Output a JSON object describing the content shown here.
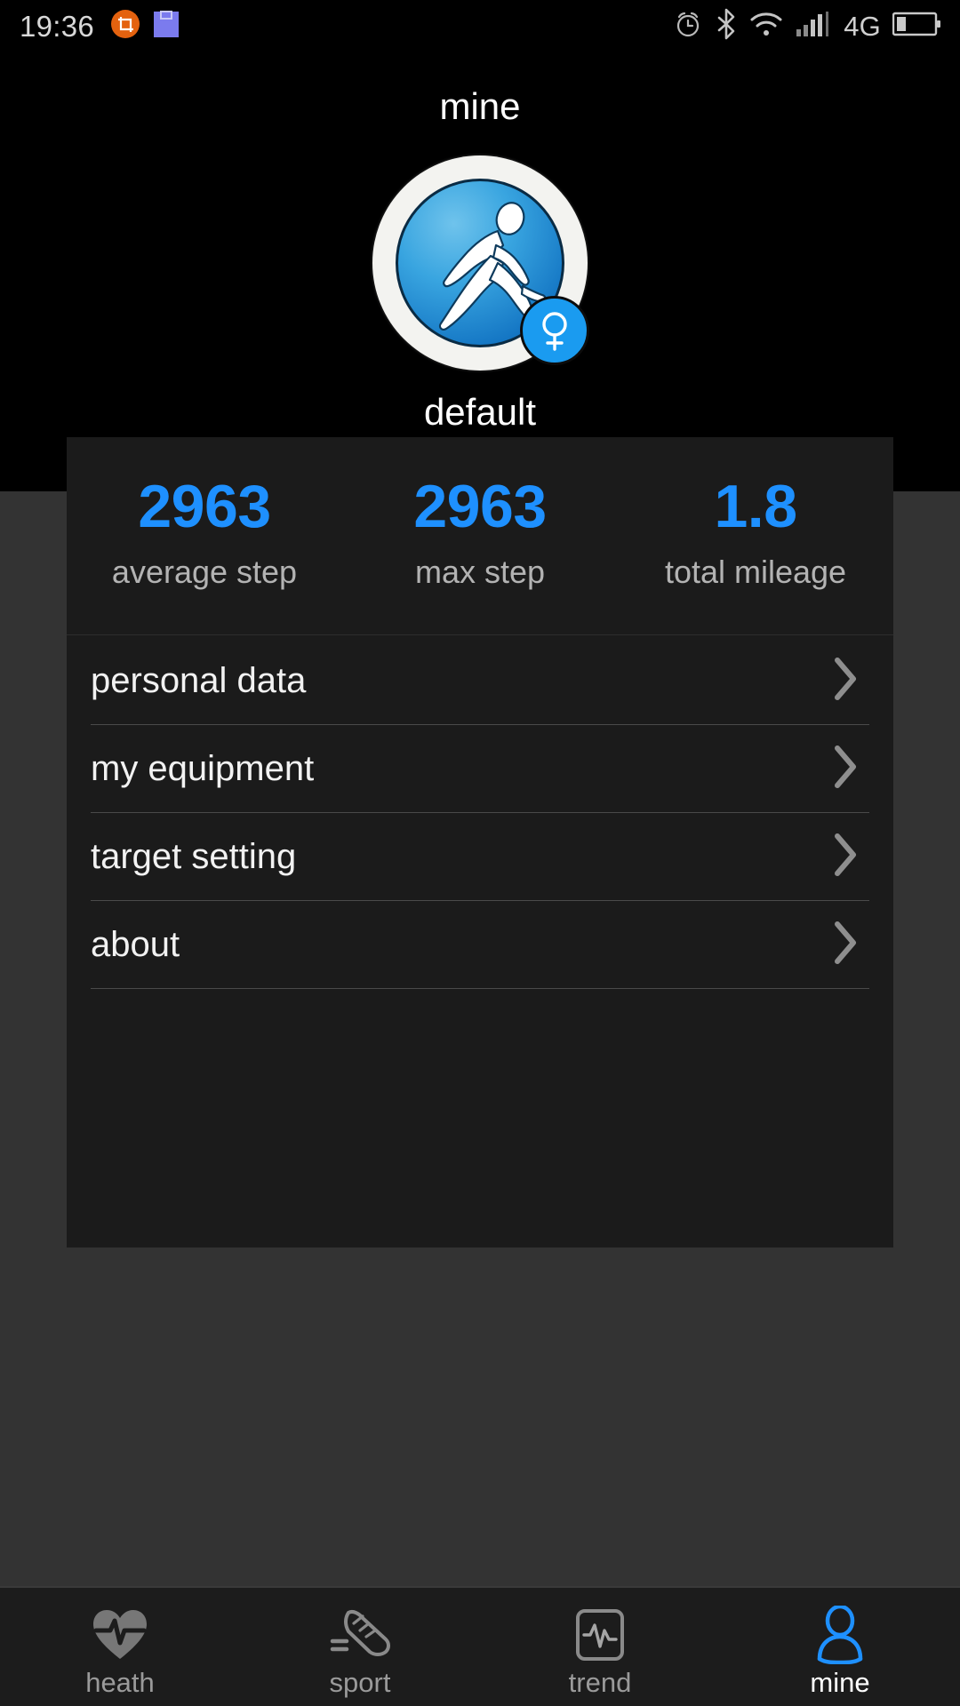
{
  "status_bar": {
    "time": "19:36",
    "left_icons": [
      "screenshot-crop-icon",
      "save-file-icon"
    ],
    "right_icons": [
      "alarm-icon",
      "bluetooth-icon",
      "wifi-icon",
      "signal-bars-icon",
      "battery-icon"
    ],
    "network_label": "4G"
  },
  "header": {
    "title": "mine"
  },
  "profile": {
    "avatar_icon": "running-person-avatar",
    "gender_badge_icon": "female-gender-icon",
    "name": "default"
  },
  "stats": [
    {
      "value": "2963",
      "label": "average step"
    },
    {
      "value": "2963",
      "label": "max step"
    },
    {
      "value": "1.8",
      "label": "total mileage"
    }
  ],
  "menu": [
    {
      "label": "personal data"
    },
    {
      "label": "my equipment"
    },
    {
      "label": "target setting"
    },
    {
      "label": "about"
    }
  ],
  "bottom_nav": [
    {
      "label": "heath",
      "icon": "heart-pulse-icon",
      "active": false
    },
    {
      "label": "sport",
      "icon": "running-shoe-icon",
      "active": false
    },
    {
      "label": "trend",
      "icon": "chart-waveform-icon",
      "active": false
    },
    {
      "label": "mine",
      "icon": "person-icon",
      "active": true
    }
  ],
  "colors": {
    "accent": "#1E90FF",
    "page_background": "#333333",
    "card_background": "#1B1B1B",
    "header_background": "#000000",
    "label_gray": "#B3B3B3",
    "nav_inactive": "#9A9A9A"
  }
}
